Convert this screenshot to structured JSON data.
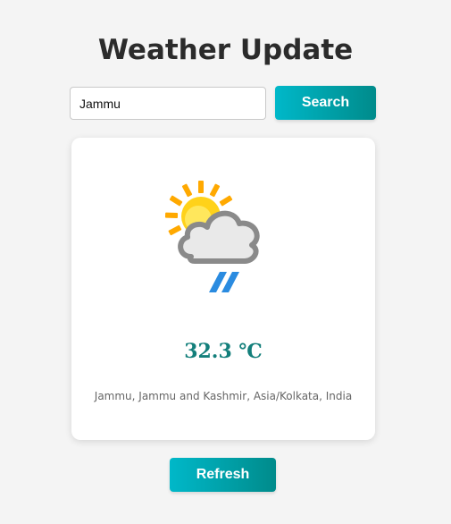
{
  "header": {
    "title": "Weather Update"
  },
  "search": {
    "value": "Jammu",
    "button_label": "Search"
  },
  "weather": {
    "icon": "partly-cloudy-rain-icon",
    "temperature": "32.3 ℃",
    "location": "Jammu, Jammu and Kashmir, Asia/Kolkata, India"
  },
  "actions": {
    "refresh_label": "Refresh"
  },
  "colors": {
    "page_bg": "#f4f4f4",
    "button_gradient_start": "#00b8c9",
    "button_gradient_end": "#008b8b",
    "temperature": "#137f7b",
    "sun": "#ffc400",
    "rain": "#2a8be0"
  }
}
